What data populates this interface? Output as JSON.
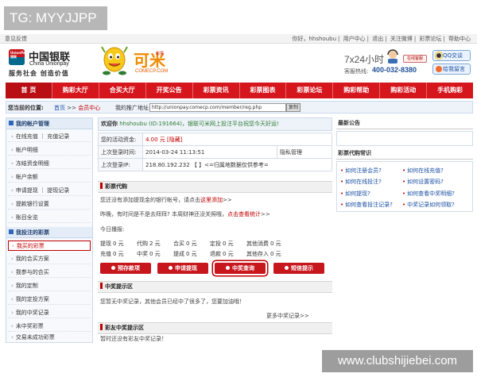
{
  "watermarks": {
    "top": "TG: MYYJJPP",
    "bottom": "www.clubshijiebei.com"
  },
  "topbar": {
    "feedback": "意见反馈",
    "right_links": [
      "你好，hhshoubu",
      "用户中心",
      "退出",
      "关注微博",
      "彩票论坛",
      "帮助中心"
    ]
  },
  "header": {
    "unionpay_cn": "中国银联",
    "unionpay_en": "China Unionpay",
    "unionpay_badge": "UnionPay 银联",
    "slogan": "服务社会  创造价值",
    "brand": "可米",
    "brand_sub": "彩票",
    "brand_url": "COMECP.COM",
    "service_hours": "7x24小时",
    "online_service": "在线客服",
    "hotline_label": "客服热线:",
    "hotline": "400-032-8380",
    "qq_service": "QQ交谈",
    "call_me": "给我留言"
  },
  "nav": [
    "首 页",
    "购彩大厅",
    "合买大厅",
    "开奖公告",
    "彩票资讯",
    "彩票图表",
    "彩票论坛",
    "购彩帮助",
    "购彩活动",
    "手机购彩"
  ],
  "location": {
    "label": "您当前的位置:",
    "crumb_home": "首页",
    "crumb_sep": ">>",
    "crumb_current": "会员中心",
    "promo_label": "我的推广地址:",
    "promo_url": "http://unionpay.comecp.com/member/reg.php",
    "copy_button": "复制"
  },
  "sidebar": {
    "sections": [
      {
        "title": "我的帐户管理",
        "items": [
          "在线充值 ｜ 充值记录",
          "帐户明细",
          "冻结资金明细",
          "帐户余额",
          "申请提现 ｜ 提现记录",
          "提款银行设置",
          "账目全览"
        ]
      },
      {
        "title": "我投注的彩票",
        "items": [
          "我买的彩票",
          "我的合买方案",
          "我参与的合买",
          "我的定制",
          "我的定投方案",
          "我的中奖记录",
          "未中奖彩票",
          "交易未成功彩票"
        ]
      }
    ]
  },
  "main": {
    "welcome_hi": "欢迎你",
    "welcome_user": "hhshoubu (ID:191664)",
    "welcome_msg": "，银联可米网上投注平台祝您今天好运!",
    "rows": [
      {
        "k": "您的活动资金:",
        "v": "4.00 元 [隐藏]"
      },
      {
        "k": "上次登录时间:",
        "v": "2014-03-24 11:13:51",
        "extra": "隐私管理"
      },
      {
        "k": "上次登录IP:",
        "v": "218.80.192.232 【 】<=归属地数据仅供参考="
      }
    ],
    "daigou_title": "彩票代购",
    "daigou_line1_a": "您还没有添加提现金的银行帐号，请点击",
    "daigou_line1_link": "这里添加",
    "daigou_line1_b": ">>",
    "daigou_line2_a": "昨晚，有时间是不是去拜拜? 本周财神还没关照哦，",
    "daigou_line2_link": "点击查看统计",
    "daigou_line2_b": ">>",
    "today_label": "今日播报:",
    "stats": [
      [
        {
          "k": "提现",
          "v": "0 元"
        },
        {
          "k": "代购",
          "v": "2 元"
        },
        {
          "k": "合买",
          "v": "0 元"
        },
        {
          "k": "定投",
          "v": "0 元"
        },
        {
          "k": "其他消费",
          "v": "0 元"
        }
      ],
      [
        {
          "k": "充值",
          "v": "0 元"
        },
        {
          "k": "中奖",
          "v": "0 元"
        },
        {
          "k": "提成",
          "v": "0 元"
        },
        {
          "k": "退款",
          "v": "0 元"
        },
        {
          "k": "其他存入",
          "v": "0 元"
        }
      ]
    ],
    "buttons": [
      "预存款项",
      "申请提现",
      "中奖查询",
      "短信提示"
    ],
    "zhongjiang_title": "中奖提示区",
    "zhongjiang_text": "您暂无中奖记录，其他会员已经中了很多了，您要加油哦！",
    "more_link": "更多中奖记录>>",
    "friend_title": "彩友中奖提示区",
    "friend_text": "暂时还没有彩友中奖记录！"
  },
  "right": {
    "news_title": "最新公告",
    "faq_title": "彩票代购常识",
    "faqs": [
      "如何注册会员?",
      "如何在线充值?",
      "如何在线投注?",
      "如何设置密码?",
      "如何提现?",
      "如何查看中奖明细?",
      "如何查看投注记录?",
      "中奖记录如何领取?"
    ]
  }
}
